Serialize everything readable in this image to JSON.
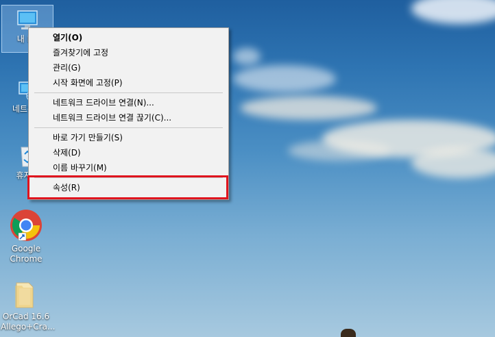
{
  "desktop": {
    "icons": [
      {
        "label": "내 PC"
      },
      {
        "label": "네트워크"
      },
      {
        "label": "휴지통"
      },
      {
        "label": "Google\nChrome"
      },
      {
        "label": "OrCad 16.6\nAllego+Cra..."
      }
    ]
  },
  "context_menu": {
    "items": [
      {
        "label": "열기(O)",
        "default": true
      },
      {
        "label": "즐겨찾기에 고정"
      },
      {
        "label": "관리(G)"
      },
      {
        "label": "시작 화면에 고정(P)"
      },
      {
        "label": "네트워크 드라이브 연결(N)..."
      },
      {
        "label": "네트워크 드라이브 연결 끊기(C)..."
      },
      {
        "label": "바로 가기 만들기(S)"
      },
      {
        "label": "삭제(D)"
      },
      {
        "label": "이름 바꾸기(M)"
      },
      {
        "label": "속성(R)"
      }
    ]
  },
  "colors": {
    "highlight_border": "#e0141e",
    "menu_background": "#f2f2f2"
  }
}
